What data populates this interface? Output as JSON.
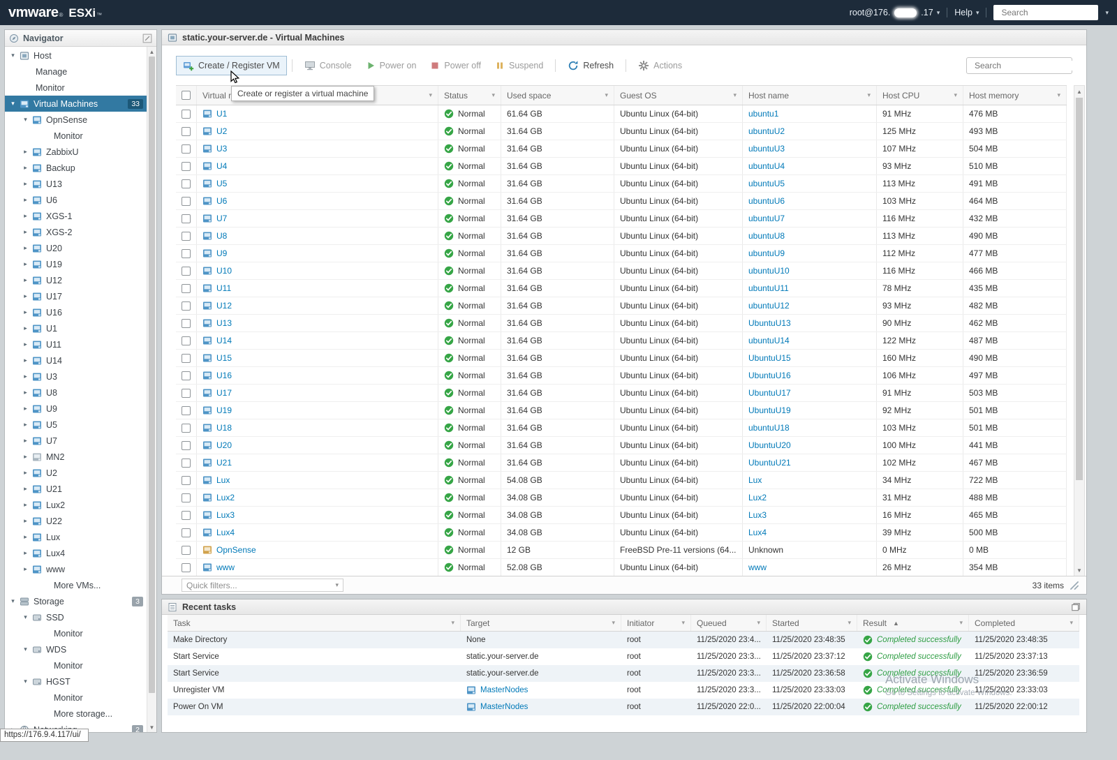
{
  "topbar": {
    "brand_vm": "vmware",
    "brand_reg": "®",
    "brand_product": "ESXi",
    "brand_tm": "™",
    "user_prefix": "root@176.",
    "user_suffix": ".17",
    "help_label": "Help",
    "search_placeholder": "Search"
  },
  "navigator": {
    "title": "Navigator",
    "items": [
      {
        "label": "Host",
        "ind": 0,
        "arrow": "down",
        "icon": "host"
      },
      {
        "label": "Manage",
        "ind": 1
      },
      {
        "label": "Monitor",
        "ind": 1
      },
      {
        "label": "Virtual Machines",
        "ind": 0,
        "arrow": "down",
        "icon": "vm",
        "badge": "33",
        "selected": true
      },
      {
        "label": "OpnSense",
        "ind": 2,
        "arrow": "down",
        "icon": "vm"
      },
      {
        "label": "Monitor",
        "ind": 3
      },
      {
        "label": "ZabbixU",
        "ind": 2,
        "arrow": "right",
        "icon": "vm"
      },
      {
        "label": "Backup",
        "ind": 2,
        "arrow": "right",
        "icon": "vm"
      },
      {
        "label": "U13",
        "ind": 2,
        "arrow": "right",
        "icon": "vm"
      },
      {
        "label": "U6",
        "ind": 2,
        "arrow": "right",
        "icon": "vm"
      },
      {
        "label": "XGS-1",
        "ind": 2,
        "arrow": "right",
        "icon": "vm"
      },
      {
        "label": "XGS-2",
        "ind": 2,
        "arrow": "right",
        "icon": "vm"
      },
      {
        "label": "U20",
        "ind": 2,
        "arrow": "right",
        "icon": "vm"
      },
      {
        "label": "U19",
        "ind": 2,
        "arrow": "right",
        "icon": "vm"
      },
      {
        "label": "U12",
        "ind": 2,
        "arrow": "right",
        "icon": "vm"
      },
      {
        "label": "U17",
        "ind": 2,
        "arrow": "right",
        "icon": "vm"
      },
      {
        "label": "U16",
        "ind": 2,
        "arrow": "right",
        "icon": "vm"
      },
      {
        "label": "U1",
        "ind": 2,
        "arrow": "right",
        "icon": "vm"
      },
      {
        "label": "U11",
        "ind": 2,
        "arrow": "right",
        "icon": "vm"
      },
      {
        "label": "U14",
        "ind": 2,
        "arrow": "right",
        "icon": "vm"
      },
      {
        "label": "U3",
        "ind": 2,
        "arrow": "right",
        "icon": "vm"
      },
      {
        "label": "U8",
        "ind": 2,
        "arrow": "right",
        "icon": "vm"
      },
      {
        "label": "U9",
        "ind": 2,
        "arrow": "right",
        "icon": "vm"
      },
      {
        "label": "U5",
        "ind": 2,
        "arrow": "right",
        "icon": "vm"
      },
      {
        "label": "U7",
        "ind": 2,
        "arrow": "right",
        "icon": "vm"
      },
      {
        "label": "MN2",
        "ind": 2,
        "arrow": "right",
        "icon": "vm-off"
      },
      {
        "label": "U2",
        "ind": 2,
        "arrow": "right",
        "icon": "vm"
      },
      {
        "label": "U21",
        "ind": 2,
        "arrow": "right",
        "icon": "vm"
      },
      {
        "label": "Lux2",
        "ind": 2,
        "arrow": "right",
        "icon": "vm"
      },
      {
        "label": "U22",
        "ind": 2,
        "arrow": "right",
        "icon": "vm"
      },
      {
        "label": "Lux",
        "ind": 2,
        "arrow": "right",
        "icon": "vm"
      },
      {
        "label": "Lux4",
        "ind": 2,
        "arrow": "right",
        "icon": "vm"
      },
      {
        "label": "www",
        "ind": 2,
        "arrow": "right",
        "icon": "vm"
      },
      {
        "label": "More VMs...",
        "ind": 3
      },
      {
        "label": "Storage",
        "ind": 0,
        "arrow": "down",
        "icon": "storage",
        "badge": "3"
      },
      {
        "label": "SSD",
        "ind": 2,
        "arrow": "down",
        "icon": "disk"
      },
      {
        "label": "Monitor",
        "ind": 3
      },
      {
        "label": "WDS",
        "ind": 2,
        "arrow": "down",
        "icon": "disk"
      },
      {
        "label": "Monitor",
        "ind": 3
      },
      {
        "label": "HGST",
        "ind": 2,
        "arrow": "down",
        "icon": "disk"
      },
      {
        "label": "Monitor",
        "ind": 3
      },
      {
        "label": "More storage...",
        "ind": 3
      },
      {
        "label": "Networking",
        "ind": 0,
        "arrow": "right",
        "icon": "network",
        "badge": "2"
      }
    ]
  },
  "main": {
    "title": "static.your-server.de - Virtual Machines",
    "toolbar": {
      "create": "Create / Register VM",
      "console": "Console",
      "power_on": "Power on",
      "power_off": "Power off",
      "suspend": "Suspend",
      "refresh": "Refresh",
      "actions": "Actions",
      "search_placeholder": "Search"
    },
    "tooltip": "Create or register a virtual machine",
    "quick_filters": "Quick filters...",
    "items_count": "33 items"
  },
  "vm_table": {
    "columns": [
      "Virtual machine",
      "Status",
      "Used space",
      "Guest OS",
      "Host name",
      "Host CPU",
      "Host memory"
    ],
    "rows": [
      {
        "name": "U1",
        "status": "Normal",
        "used": "61.64 GB",
        "os": "Ubuntu Linux (64-bit)",
        "host": "ubuntu1",
        "host_link": true,
        "cpu": "91 MHz",
        "mem": "476 MB"
      },
      {
        "name": "U2",
        "status": "Normal",
        "used": "31.64 GB",
        "os": "Ubuntu Linux (64-bit)",
        "host": "ubuntuU2",
        "host_link": true,
        "cpu": "125 MHz",
        "mem": "493 MB"
      },
      {
        "name": "U3",
        "status": "Normal",
        "used": "31.64 GB",
        "os": "Ubuntu Linux (64-bit)",
        "host": "ubuntuU3",
        "host_link": true,
        "cpu": "107 MHz",
        "mem": "504 MB"
      },
      {
        "name": "U4",
        "status": "Normal",
        "used": "31.64 GB",
        "os": "Ubuntu Linux (64-bit)",
        "host": "ubuntuU4",
        "host_link": true,
        "cpu": "93 MHz",
        "mem": "510 MB"
      },
      {
        "name": "U5",
        "status": "Normal",
        "used": "31.64 GB",
        "os": "Ubuntu Linux (64-bit)",
        "host": "ubuntuU5",
        "host_link": true,
        "cpu": "113 MHz",
        "mem": "491 MB"
      },
      {
        "name": "U6",
        "status": "Normal",
        "used": "31.64 GB",
        "os": "Ubuntu Linux (64-bit)",
        "host": "ubuntuU6",
        "host_link": true,
        "cpu": "103 MHz",
        "mem": "464 MB"
      },
      {
        "name": "U7",
        "status": "Normal",
        "used": "31.64 GB",
        "os": "Ubuntu Linux (64-bit)",
        "host": "ubuntuU7",
        "host_link": true,
        "cpu": "116 MHz",
        "mem": "432 MB"
      },
      {
        "name": "U8",
        "status": "Normal",
        "used": "31.64 GB",
        "os": "Ubuntu Linux (64-bit)",
        "host": "ubuntuU8",
        "host_link": true,
        "cpu": "113 MHz",
        "mem": "490 MB"
      },
      {
        "name": "U9",
        "status": "Normal",
        "used": "31.64 GB",
        "os": "Ubuntu Linux (64-bit)",
        "host": "ubuntuU9",
        "host_link": true,
        "cpu": "112 MHz",
        "mem": "477 MB"
      },
      {
        "name": "U10",
        "status": "Normal",
        "used": "31.64 GB",
        "os": "Ubuntu Linux (64-bit)",
        "host": "ubuntuU10",
        "host_link": true,
        "cpu": "116 MHz",
        "mem": "466 MB"
      },
      {
        "name": "U11",
        "status": "Normal",
        "used": "31.64 GB",
        "os": "Ubuntu Linux (64-bit)",
        "host": "ubuntuU11",
        "host_link": true,
        "cpu": "78 MHz",
        "mem": "435 MB"
      },
      {
        "name": "U12",
        "status": "Normal",
        "used": "31.64 GB",
        "os": "Ubuntu Linux (64-bit)",
        "host": "ubuntuU12",
        "host_link": true,
        "cpu": "93 MHz",
        "mem": "482 MB"
      },
      {
        "name": "U13",
        "status": "Normal",
        "used": "31.64 GB",
        "os": "Ubuntu Linux (64-bit)",
        "host": "UbuntuU13",
        "host_link": true,
        "cpu": "90 MHz",
        "mem": "462 MB"
      },
      {
        "name": "U14",
        "status": "Normal",
        "used": "31.64 GB",
        "os": "Ubuntu Linux (64-bit)",
        "host": "ubuntuU14",
        "host_link": true,
        "cpu": "122 MHz",
        "mem": "487 MB"
      },
      {
        "name": "U15",
        "status": "Normal",
        "used": "31.64 GB",
        "os": "Ubuntu Linux (64-bit)",
        "host": "UbuntuU15",
        "host_link": true,
        "cpu": "160 MHz",
        "mem": "490 MB"
      },
      {
        "name": "U16",
        "status": "Normal",
        "used": "31.64 GB",
        "os": "Ubuntu Linux (64-bit)",
        "host": "UbuntuU16",
        "host_link": true,
        "cpu": "106 MHz",
        "mem": "497 MB"
      },
      {
        "name": "U17",
        "status": "Normal",
        "used": "31.64 GB",
        "os": "Ubuntu Linux (64-bit)",
        "host": "UbuntuU17",
        "host_link": true,
        "cpu": "91 MHz",
        "mem": "503 MB"
      },
      {
        "name": "U19",
        "status": "Normal",
        "used": "31.64 GB",
        "os": "Ubuntu Linux (64-bit)",
        "host": "UbuntuU19",
        "host_link": true,
        "cpu": "92 MHz",
        "mem": "501 MB"
      },
      {
        "name": "U18",
        "status": "Normal",
        "used": "31.64 GB",
        "os": "Ubuntu Linux (64-bit)",
        "host": "ubuntuU18",
        "host_link": true,
        "cpu": "103 MHz",
        "mem": "501 MB"
      },
      {
        "name": "U20",
        "status": "Normal",
        "used": "31.64 GB",
        "os": "Ubuntu Linux (64-bit)",
        "host": "UbuntuU20",
        "host_link": true,
        "cpu": "100 MHz",
        "mem": "441 MB"
      },
      {
        "name": "U21",
        "status": "Normal",
        "used": "31.64 GB",
        "os": "Ubuntu Linux (64-bit)",
        "host": "UbuntuU21",
        "host_link": true,
        "cpu": "102 MHz",
        "mem": "467 MB"
      },
      {
        "name": "Lux",
        "status": "Normal",
        "used": "54.08 GB",
        "os": "Ubuntu Linux (64-bit)",
        "host": "Lux",
        "host_link": true,
        "cpu": "34 MHz",
        "mem": "722 MB"
      },
      {
        "name": "Lux2",
        "status": "Normal",
        "used": "34.08 GB",
        "os": "Ubuntu Linux (64-bit)",
        "host": "Lux2",
        "host_link": true,
        "cpu": "31 MHz",
        "mem": "488 MB"
      },
      {
        "name": "Lux3",
        "status": "Normal",
        "used": "34.08 GB",
        "os": "Ubuntu Linux (64-bit)",
        "host": "Lux3",
        "host_link": true,
        "cpu": "16 MHz",
        "mem": "465 MB"
      },
      {
        "name": "Lux4",
        "status": "Normal",
        "used": "34.08 GB",
        "os": "Ubuntu Linux (64-bit)",
        "host": "Lux4",
        "host_link": true,
        "cpu": "39 MHz",
        "mem": "500 MB"
      },
      {
        "name": "OpnSense",
        "status": "Normal",
        "used": "12 GB",
        "os": "FreeBSD Pre-11 versions (64...",
        "host": "Unknown",
        "host_link": false,
        "cpu": "0 MHz",
        "mem": "0 MB",
        "icon": "vm-warn"
      },
      {
        "name": "www",
        "status": "Normal",
        "used": "52.08 GB",
        "os": "Ubuntu Linux (64-bit)",
        "host": "www",
        "host_link": true,
        "cpu": "26 MHz",
        "mem": "354 MB"
      }
    ]
  },
  "tasks": {
    "title": "Recent tasks",
    "columns": [
      "Task",
      "Target",
      "Initiator",
      "Queued",
      "Started",
      "Result",
      "Completed"
    ],
    "sort_column": "Result",
    "rows": [
      {
        "task": "Make Directory",
        "target": "None",
        "target_icon": false,
        "initiator": "root",
        "queued": "11/25/2020 23:4...",
        "started": "11/25/2020 23:48:35",
        "result": "Completed successfully",
        "completed": "11/25/2020 23:48:35"
      },
      {
        "task": "Start Service",
        "target": "static.your-server.de",
        "target_icon": false,
        "initiator": "root",
        "queued": "11/25/2020 23:3...",
        "started": "11/25/2020 23:37:12",
        "result": "Completed successfully",
        "completed": "11/25/2020 23:37:13"
      },
      {
        "task": "Start Service",
        "target": "static.your-server.de",
        "target_icon": false,
        "initiator": "root",
        "queued": "11/25/2020 23:3...",
        "started": "11/25/2020 23:36:58",
        "result": "Completed successfully",
        "completed": "11/25/2020 23:36:59"
      },
      {
        "task": "Unregister VM",
        "target": "MasterNodes",
        "target_icon": true,
        "initiator": "root",
        "queued": "11/25/2020 23:3...",
        "started": "11/25/2020 23:33:03",
        "result": "Completed successfully",
        "completed": "11/25/2020 23:33:03"
      },
      {
        "task": "Power On VM",
        "target": "MasterNodes",
        "target_icon": true,
        "initiator": "root",
        "queued": "11/25/2020 22:0...",
        "started": "11/25/2020 22:00:04",
        "result": "Completed successfully",
        "completed": "11/25/2020 22:00:12"
      }
    ]
  },
  "watermark": {
    "line1": "Activate Windows",
    "line2": "Go to Settings to activate Windows."
  },
  "status_bubble": "https://176.9.4.117/ui/"
}
